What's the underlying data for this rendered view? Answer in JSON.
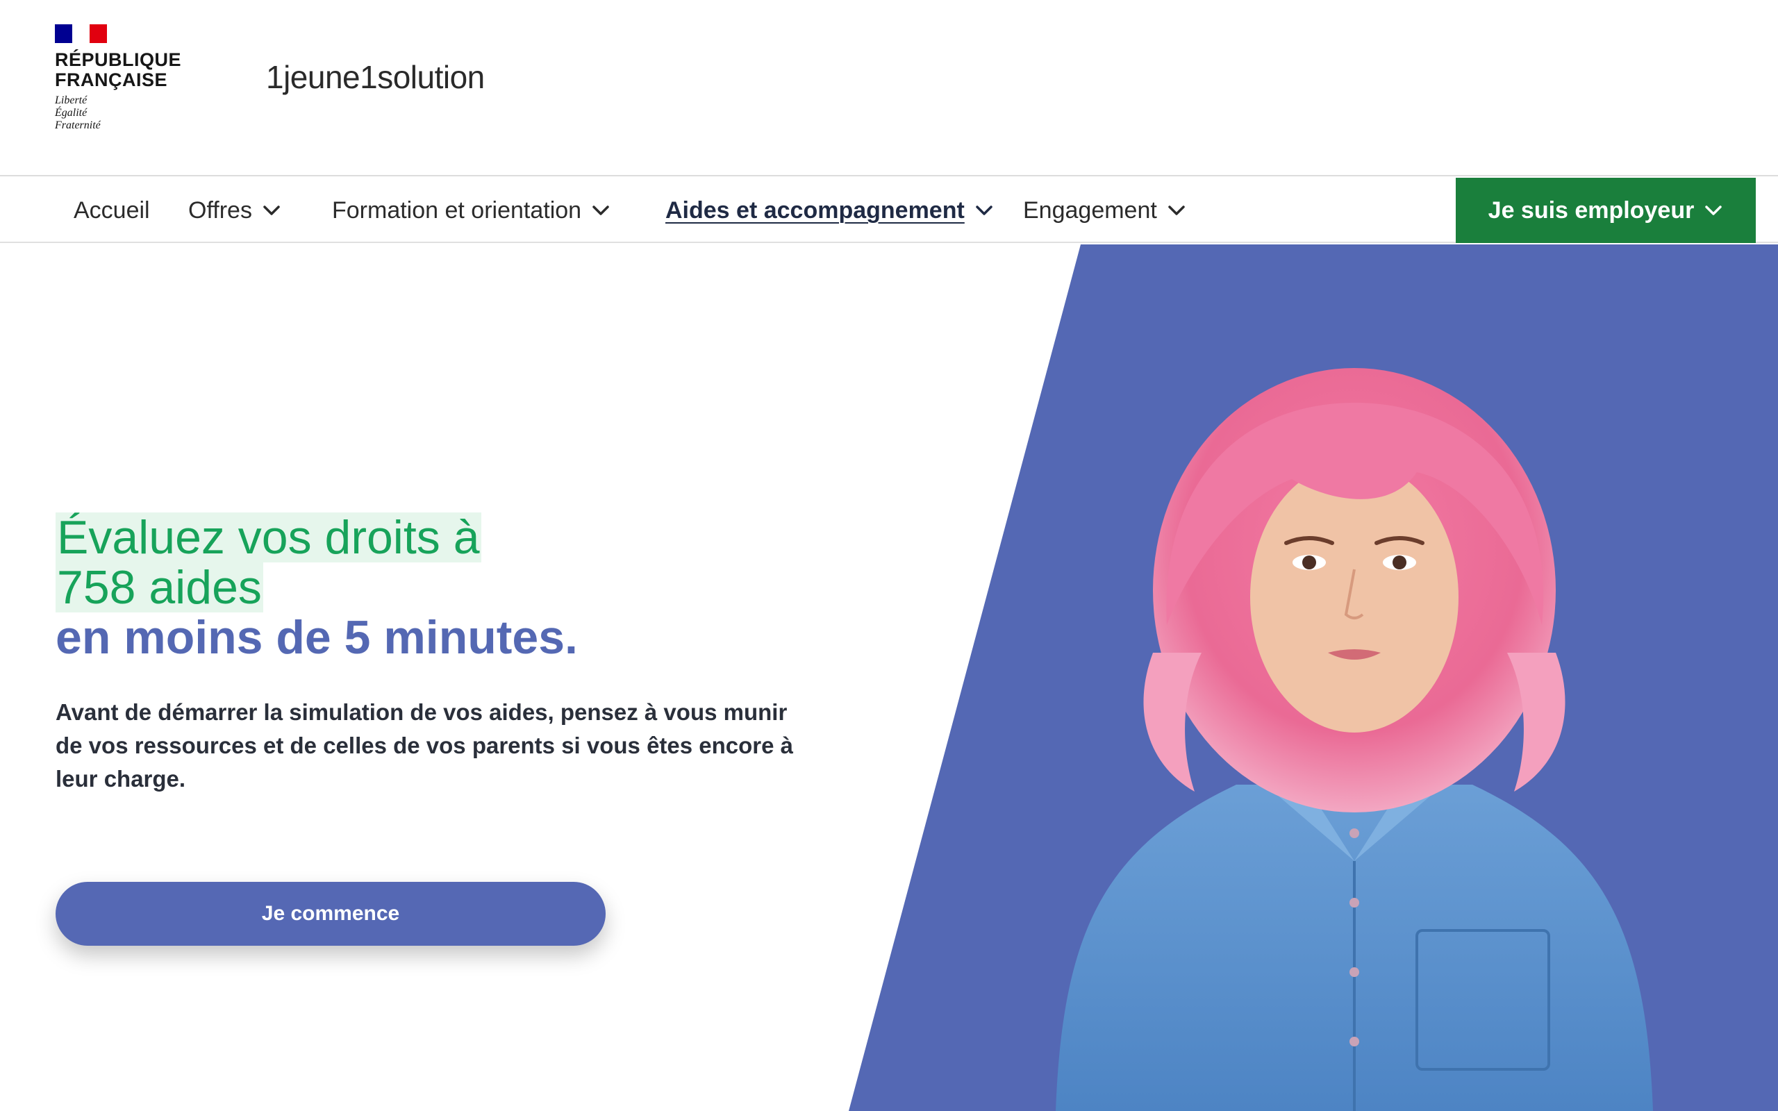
{
  "header": {
    "gov_logo": {
      "title_line1": "République",
      "title_line2": "Française",
      "motto_1": "Liberté",
      "motto_2": "Égalité",
      "motto_3": "Fraternité"
    },
    "site_name": "1jeune1solution"
  },
  "nav": {
    "items": [
      {
        "label": "Accueil",
        "has_dropdown": false
      },
      {
        "label": "Offres",
        "has_dropdown": true
      },
      {
        "label": "Formation et orientation",
        "has_dropdown": true
      },
      {
        "label": "Aides et accompagnement",
        "has_dropdown": true,
        "active": true
      },
      {
        "label": "Engagement",
        "has_dropdown": true
      }
    ],
    "employer_button": "Je suis employeur"
  },
  "hero": {
    "headline_line1": "Évaluez vos droits à",
    "headline_line2": "758 aides",
    "headline_line3": "en moins de 5 minutes.",
    "intro": "Avant de démarrer la simulation de vos aides, pensez à vous munir de vos ressources et de celles de vos parents si vous êtes encore à leur charge.",
    "cta_label": "Je commence"
  },
  "colors": {
    "accent_green": "#1a7f3c",
    "headline_green": "#17a35a",
    "brand_blue": "#5468b3",
    "gov_blue": "#000091",
    "gov_red": "#e1000f"
  },
  "icons": [
    "chevron-down-icon",
    "marianne-flag-icon"
  ]
}
